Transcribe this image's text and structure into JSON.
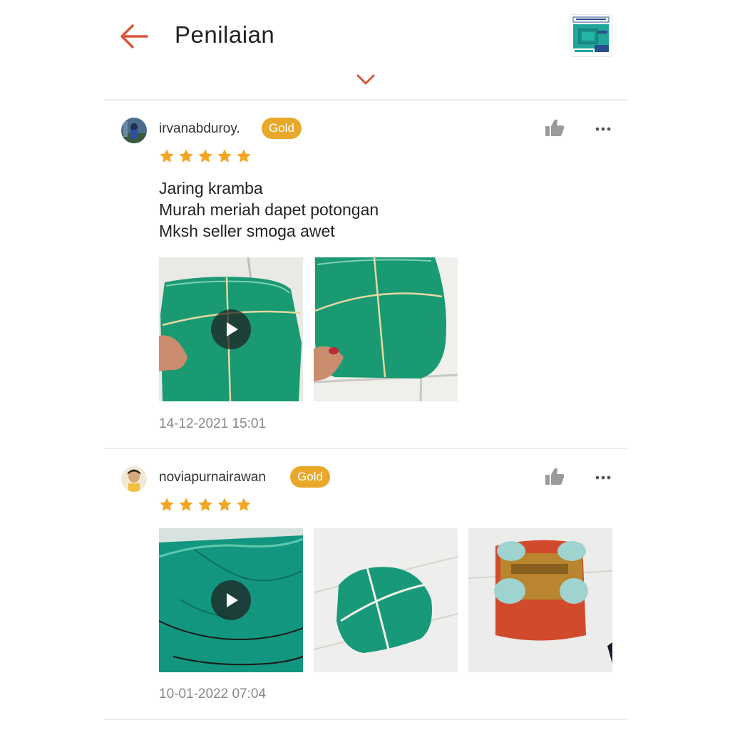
{
  "header": {
    "title": "Penilaian",
    "back_icon": "arrow-left-icon",
    "expand_icon": "chevron-down-icon",
    "accent_color": "#d9553a"
  },
  "reviews": [
    {
      "username": "irvanabduroy.",
      "badge": "Gold",
      "rating": 5,
      "text_lines": [
        "Jaring kramba",
        "Murah meriah dapet potongan",
        "Mksh seller smoga awet"
      ],
      "media": [
        {
          "type": "video",
          "description_icon": "play-icon"
        },
        {
          "type": "image"
        }
      ],
      "timestamp": "14-12-2021 15:01"
    },
    {
      "username": "noviapurnairawan",
      "badge": "Gold",
      "rating": 5,
      "text_lines": [],
      "media": [
        {
          "type": "video",
          "description_icon": "play-icon"
        },
        {
          "type": "image"
        },
        {
          "type": "image"
        }
      ],
      "timestamp": "10-01-2022 07:04"
    }
  ],
  "colors": {
    "badge": "#e8a92b",
    "star": "#f2a623",
    "net_green": "#1a9a72"
  }
}
